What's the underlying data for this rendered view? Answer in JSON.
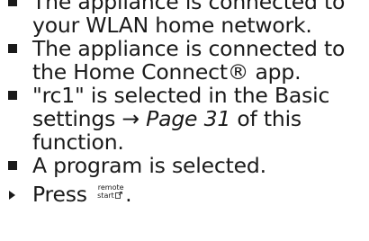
{
  "bullets": [
    {
      "text": "The appliance is connected to your WLAN home network."
    },
    {
      "text": "The appliance is connected to the Home Connect® app."
    },
    {
      "prefix": "\"rc1\" is selected in the Basic settings ",
      "arrow": "→",
      "page_ref": "Page 31",
      "suffix": " of this function."
    },
    {
      "text": "A program is selected."
    }
  ],
  "action": {
    "verb": "Press",
    "button_top": "remote",
    "button_bottom": "start",
    "button_icon": "remote-start-icon",
    "end": "."
  }
}
